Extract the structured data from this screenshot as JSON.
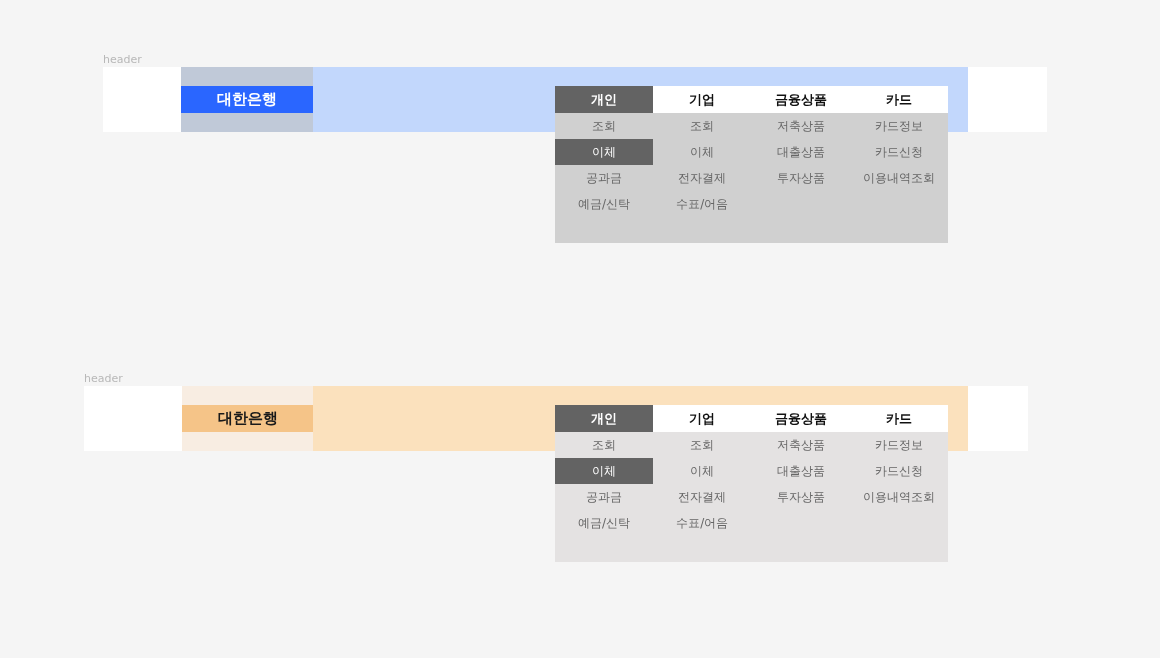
{
  "headers": [
    {
      "kind": "blue",
      "label": "header",
      "logo": "대한은행",
      "menus": [
        {
          "label": "개인",
          "selected": true,
          "items": [
            {
              "label": "조회",
              "selected": false
            },
            {
              "label": "이체",
              "selected": true
            },
            {
              "label": "공과금",
              "selected": false
            },
            {
              "label": "예금/신탁",
              "selected": false
            }
          ]
        },
        {
          "label": "기업",
          "selected": false,
          "items": [
            {
              "label": "조회",
              "selected": false
            },
            {
              "label": "이체",
              "selected": false
            },
            {
              "label": "전자결제",
              "selected": false
            },
            {
              "label": "수표/어음",
              "selected": false
            }
          ]
        },
        {
          "label": "금융상품",
          "selected": false,
          "items": [
            {
              "label": "저축상품",
              "selected": false
            },
            {
              "label": "대출상품",
              "selected": false
            },
            {
              "label": "투자상품",
              "selected": false
            }
          ]
        },
        {
          "label": "카드",
          "selected": false,
          "items": [
            {
              "label": "카드정보",
              "selected": false
            },
            {
              "label": "카드신청",
              "selected": false
            },
            {
              "label": "이용내역조회",
              "selected": false
            }
          ]
        }
      ]
    },
    {
      "kind": "orange",
      "label": "header",
      "logo": "대한은행",
      "menus": [
        {
          "label": "개인",
          "selected": true,
          "items": [
            {
              "label": "조회",
              "selected": false
            },
            {
              "label": "이체",
              "selected": true
            },
            {
              "label": "공과금",
              "selected": false
            },
            {
              "label": "예금/신탁",
              "selected": false
            }
          ]
        },
        {
          "label": "기업",
          "selected": false,
          "items": [
            {
              "label": "조회",
              "selected": false
            },
            {
              "label": "이체",
              "selected": false
            },
            {
              "label": "전자결제",
              "selected": false
            },
            {
              "label": "수표/어음",
              "selected": false
            }
          ]
        },
        {
          "label": "금융상품",
          "selected": false,
          "items": [
            {
              "label": "저축상품",
              "selected": false
            },
            {
              "label": "대출상품",
              "selected": false
            },
            {
              "label": "투자상품",
              "selected": false
            }
          ]
        },
        {
          "label": "카드",
          "selected": false,
          "items": [
            {
              "label": "카드정보",
              "selected": false
            },
            {
              "label": "카드신청",
              "selected": false
            },
            {
              "label": "이용내역조회",
              "selected": false
            }
          ]
        }
      ]
    }
  ]
}
